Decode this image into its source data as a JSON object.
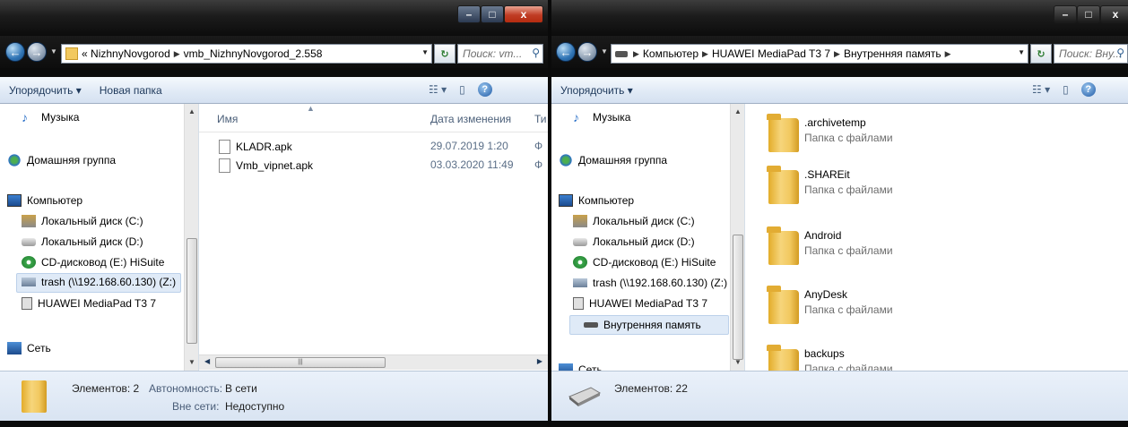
{
  "left": {
    "address": {
      "crumbs": [
        "«",
        "NizhnyNovgorod",
        "vmb_NizhnyNovgorod_2.558"
      ]
    },
    "search_placeholder": "Поиск: vm...",
    "toolbar": {
      "organize": "Упорядочить ▾",
      "new_folder": "Новая папка"
    },
    "nav": {
      "music": "Музыка",
      "homegroup": "Домашняя группа",
      "computer": "Компьютер",
      "disk_c": "Локальный диск (C:)",
      "disk_d": "Локальный диск (D:)",
      "cd": "CD-дисковод (E:) HiSuite",
      "trash": "trash (\\\\192.168.60.130) (Z:)",
      "huawei": "HUAWEI MediaPad T3 7",
      "network": "Сеть"
    },
    "columns": {
      "name": "Имя",
      "date": "Дата изменения",
      "type": "Ти"
    },
    "files": [
      {
        "name": "KLADR.apk",
        "date": "29.07.2019 1:20",
        "type": "Ф"
      },
      {
        "name": "Vmb_vipnet.apk",
        "date": "03.03.2020 11:49",
        "type": "Ф"
      }
    ],
    "status": {
      "items": "Элементов: 2",
      "offline_label": "Автономность:",
      "offline_value": "В сети",
      "avail_label": "Вне сети:",
      "avail_value": "Недоступно"
    }
  },
  "right": {
    "address": {
      "crumbs": [
        "Компьютер",
        "HUAWEI MediaPad T3 7",
        "Внутренняя память"
      ]
    },
    "search_placeholder": "Поиск: Вну...",
    "toolbar": {
      "organize": "Упорядочить ▾"
    },
    "nav": {
      "music": "Музыка",
      "homegroup": "Домашняя группа",
      "computer": "Компьютер",
      "disk_c": "Локальный диск (C:)",
      "disk_d": "Локальный диск (D:)",
      "cd": "CD-дисковод (E:) HiSuite",
      "trash": "trash (\\\\192.168.60.130) (Z:)",
      "huawei": "HUAWEI MediaPad T3 7",
      "internal": "Внутренняя память",
      "network": "Сеть"
    },
    "folders": [
      {
        "name": ".archivetemp",
        "type": "Папка с файлами"
      },
      {
        "name": ".SHAREit",
        "type": "Папка с файлами"
      },
      {
        "name": "Android",
        "type": "Папка с файлами"
      },
      {
        "name": "AnyDesk",
        "type": "Папка с файлами"
      },
      {
        "name": "backups",
        "type": "Папка с файлами"
      }
    ],
    "status": {
      "items": "Элементов: 22"
    }
  },
  "window_controls": {
    "minimize": "–",
    "maximize": "□",
    "close": "x"
  },
  "colors": {
    "toolbar_bg": "#dfe9f5",
    "status_bg": "#d9e4f2",
    "folder": "#f2c960",
    "close_btn": "#c03c24"
  }
}
